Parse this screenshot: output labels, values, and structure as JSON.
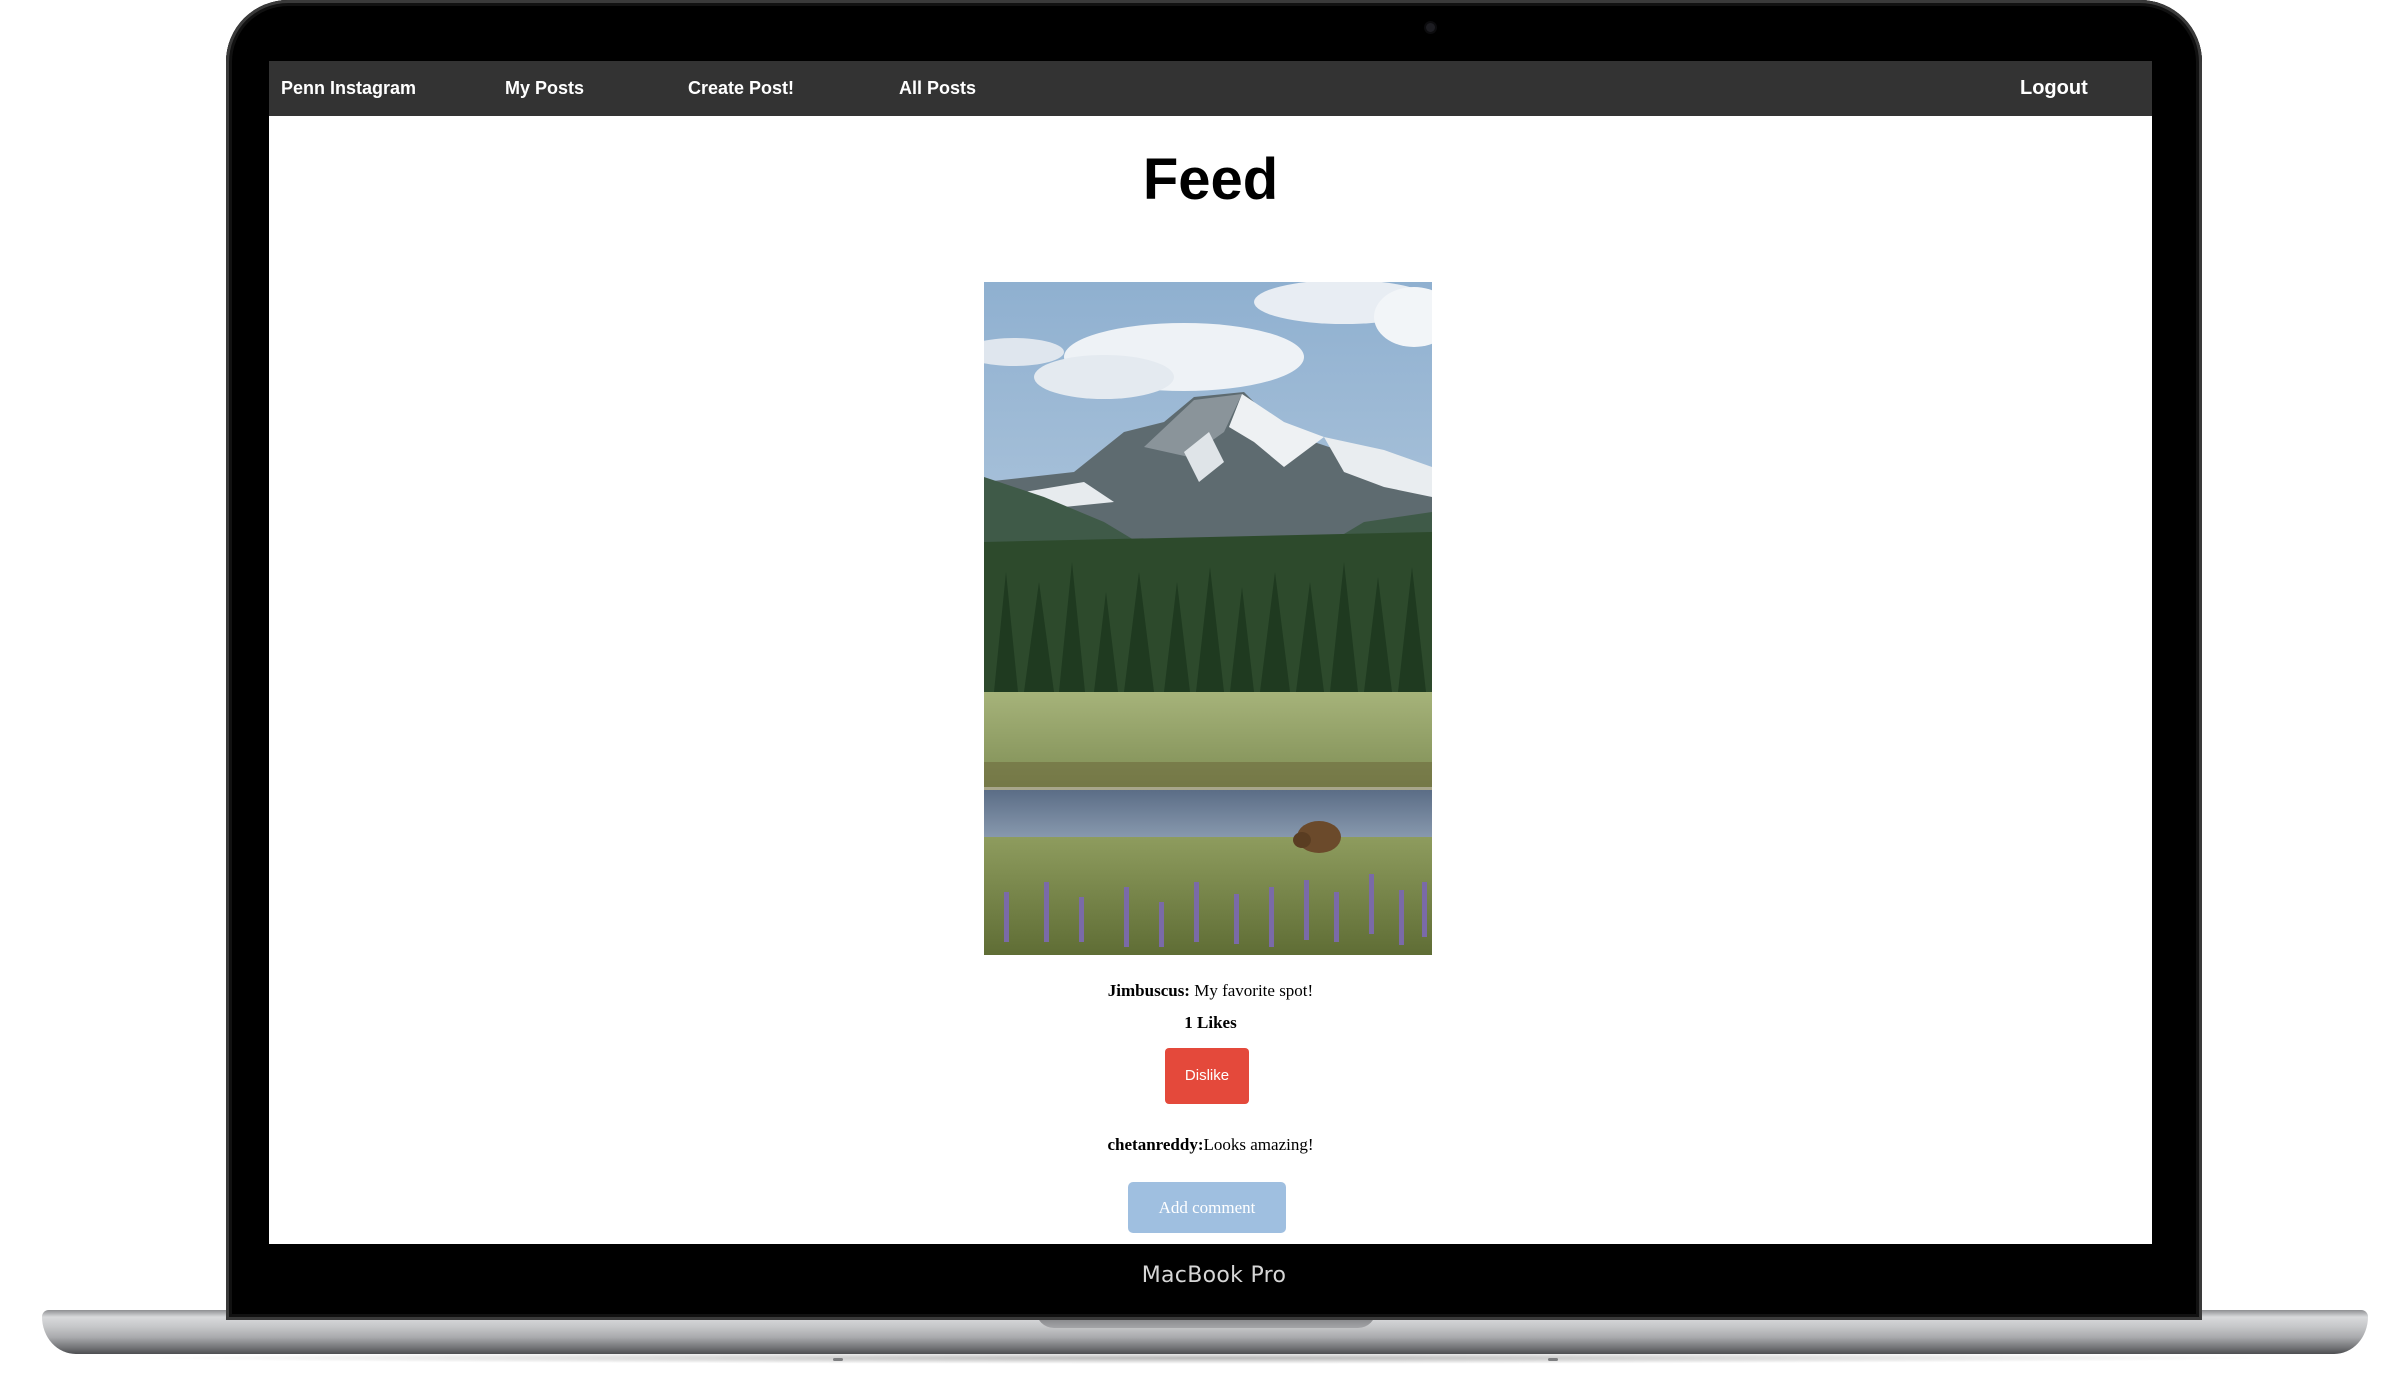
{
  "device": {
    "label": "MacBook Pro"
  },
  "navbar": {
    "brand": "Penn Instagram",
    "links": [
      "My Posts",
      "Create Post!",
      "All Posts"
    ],
    "logout": "Logout",
    "background": "#333333"
  },
  "page": {
    "title": "Feed"
  },
  "post": {
    "image_icon": "landscape-photo",
    "author": "Jimbuscus:",
    "caption": " My favorite spot!",
    "likes": "1 Likes",
    "dislike_label": "Dislike",
    "comments": [
      {
        "author": "chetanreddy:",
        "text": "Looks amazing!"
      }
    ],
    "add_comment_label": "Add comment"
  },
  "colors": {
    "dislike": "#e4493b",
    "add_comment": "#9fbfe0"
  }
}
